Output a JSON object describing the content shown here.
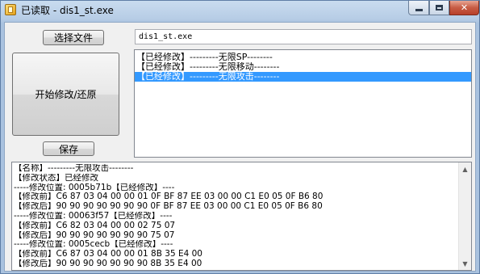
{
  "window": {
    "title": "已读取 - dis1_st.exe",
    "icon": "app-icon"
  },
  "buttons": {
    "select_file": "选择文件",
    "start_modify": "开始修改/还原",
    "save": "保存"
  },
  "file_field": {
    "value": "dis1_st.exe"
  },
  "patch_list": {
    "items": [
      {
        "label": "【已经修改】---------无限SP--------",
        "selected": false
      },
      {
        "label": "【已经修改】---------无限移动--------",
        "selected": false
      },
      {
        "label": "【已经修改】---------无限攻击--------",
        "selected": true
      }
    ]
  },
  "log": {
    "lines": [
      "【名称】---------无限攻击--------",
      "【修改状态】已经修改",
      "-----修改位置: 0005b71b【已经修改】----",
      "【修改前】C6 87 03 04 00 00 01 0F BF 87 EE 03 00 00 C1 E0 05 0F B6 80",
      "【修改后】90 90 90 90 90 90 90 0F BF 87 EE 03 00 00 C1 E0 05 0F B6 80",
      "-----修改位置: 00063f57【已经修改】----",
      "【修改前】C6 82 03 04 00 00 02 75 07",
      "【修改后】90 90 90 90 90 90 90 75 07",
      "-----修改位置: 0005cecb【已经修改】----",
      "【修改前】C6 87 03 04 00 00 01 8B 35 E4 00",
      "【修改后】90 90 90 90 90 90 90 8B 35 E4 00"
    ]
  }
}
